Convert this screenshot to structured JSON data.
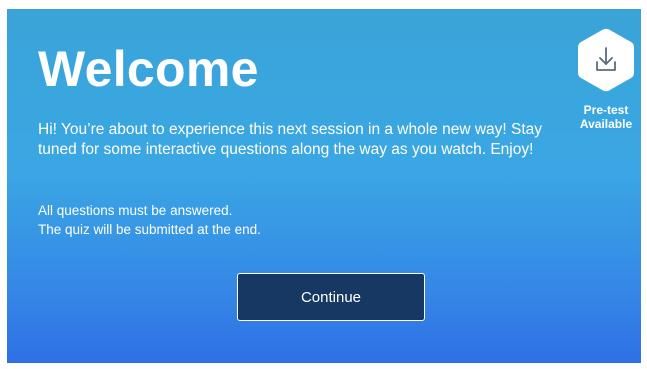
{
  "welcome": {
    "title": "Welcome",
    "intro": "Hi! You’re about to experience this next session in a whole new way! Stay tuned for some interactive questions along the way as you watch. Enjoy!",
    "notes": [
      "All questions must be answered.",
      "The quiz will be submitted at the end."
    ],
    "continue_label": "Continue"
  },
  "pretest": {
    "label_line1": "Pre-test",
    "label_line2": "Available",
    "icon": "download-icon"
  },
  "colors": {
    "background_top": "#3aa4d8",
    "background_bottom": "#2f6fe6",
    "button_fill": "#163863",
    "text": "#ffffff"
  }
}
